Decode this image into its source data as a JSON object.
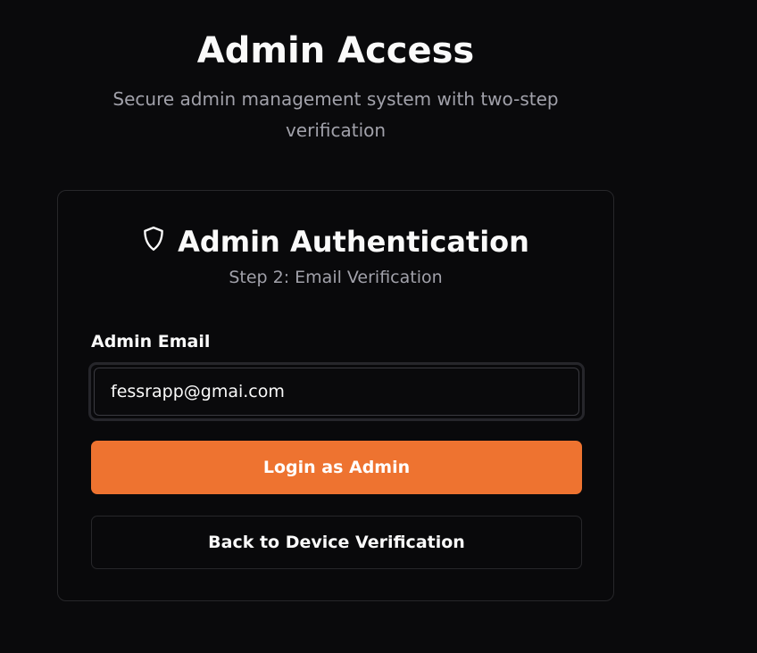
{
  "hero": {
    "title": "Admin Access",
    "subtitle": "Secure admin management system with two-step verification"
  },
  "card": {
    "icon": "shield-icon",
    "title": "Admin Authentication",
    "step": "Step 2: Email Verification",
    "email_label": "Admin Email",
    "email_value": "fessrapp@gmai.com",
    "login_button": "Login as Admin",
    "back_button": "Back to Device Verification"
  },
  "colors": {
    "background": "#0a0a0c",
    "accent": "#ee7330",
    "muted_text": "#a1a1aa",
    "border": "#27272a"
  }
}
